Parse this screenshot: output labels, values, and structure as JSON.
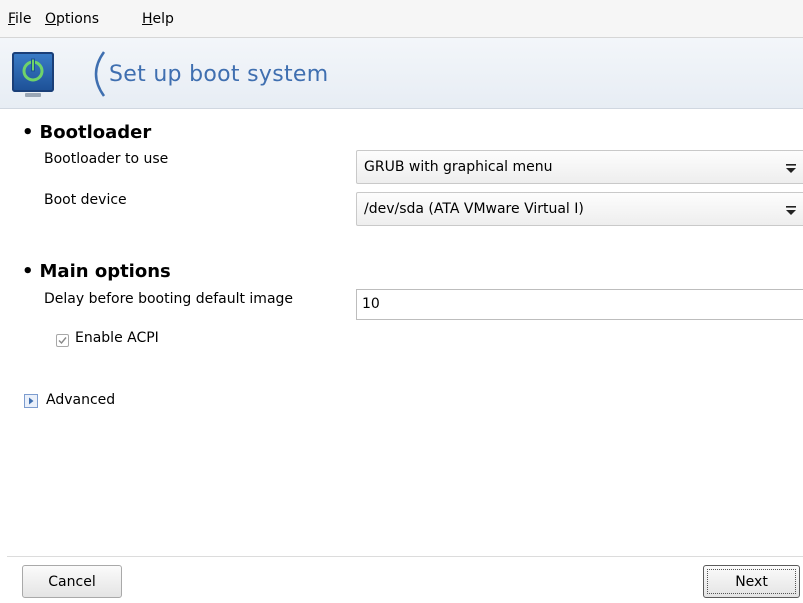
{
  "menubar": {
    "file": {
      "mnemonic": "F",
      "rest": "ile"
    },
    "options": {
      "mnemonic": "O",
      "rest": "ptions"
    },
    "help": {
      "mnemonic": "H",
      "rest": "elp"
    }
  },
  "header": {
    "title": "Set up boot system",
    "icon": "power-monitor-icon"
  },
  "bootloader_section": {
    "title": "Bootloader",
    "bootloader_to_use_label": "Bootloader to use",
    "bootloader_to_use_value": "GRUB with graphical menu",
    "boot_device_label": "Boot device",
    "boot_device_value": "/dev/sda (ATA VMware Virtual I)"
  },
  "main_options_section": {
    "title": "Main options",
    "delay_label": "Delay before booting default image",
    "delay_value": "10",
    "acpi_label": "Enable ACPI",
    "acpi_checked": true
  },
  "advanced": {
    "label": "Advanced",
    "icon": "expander-arrow-icon"
  },
  "buttons": {
    "cancel": "Cancel",
    "next": "Next"
  },
  "colors": {
    "title_blue": "#3f6fb0",
    "icon_blue": "#1c4f95",
    "power_green": "#6fd36a"
  }
}
